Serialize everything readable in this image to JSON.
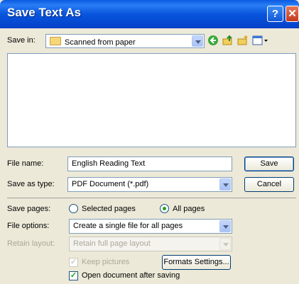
{
  "window": {
    "title": "Save Text As",
    "help_glyph": "?",
    "close_glyph": "✕"
  },
  "save_in": {
    "label": "Save in:",
    "value": "Scanned from paper",
    "icons": [
      "back-icon",
      "up-folder-icon",
      "new-folder-icon",
      "views-menu-icon"
    ]
  },
  "file_name": {
    "label": "File name:",
    "value": "English Reading Text"
  },
  "save_as_type": {
    "label": "Save as type:",
    "value": "PDF Document (*.pdf)"
  },
  "buttons": {
    "save": "Save",
    "cancel": "Cancel",
    "formats": "Formats Settings..."
  },
  "save_pages": {
    "label": "Save pages:",
    "selected_label": "Selected pages",
    "all_label": "All pages",
    "selected": "all"
  },
  "file_options": {
    "label": "File options:",
    "value": "Create a single file for all pages"
  },
  "retain_layout": {
    "label": "Retain layout:",
    "value": "Retain full page layout",
    "enabled": false
  },
  "keep_pictures": {
    "label": "Keep pictures",
    "checked": true,
    "enabled": false
  },
  "open_after": {
    "label": "Open document after saving",
    "checked": true
  }
}
